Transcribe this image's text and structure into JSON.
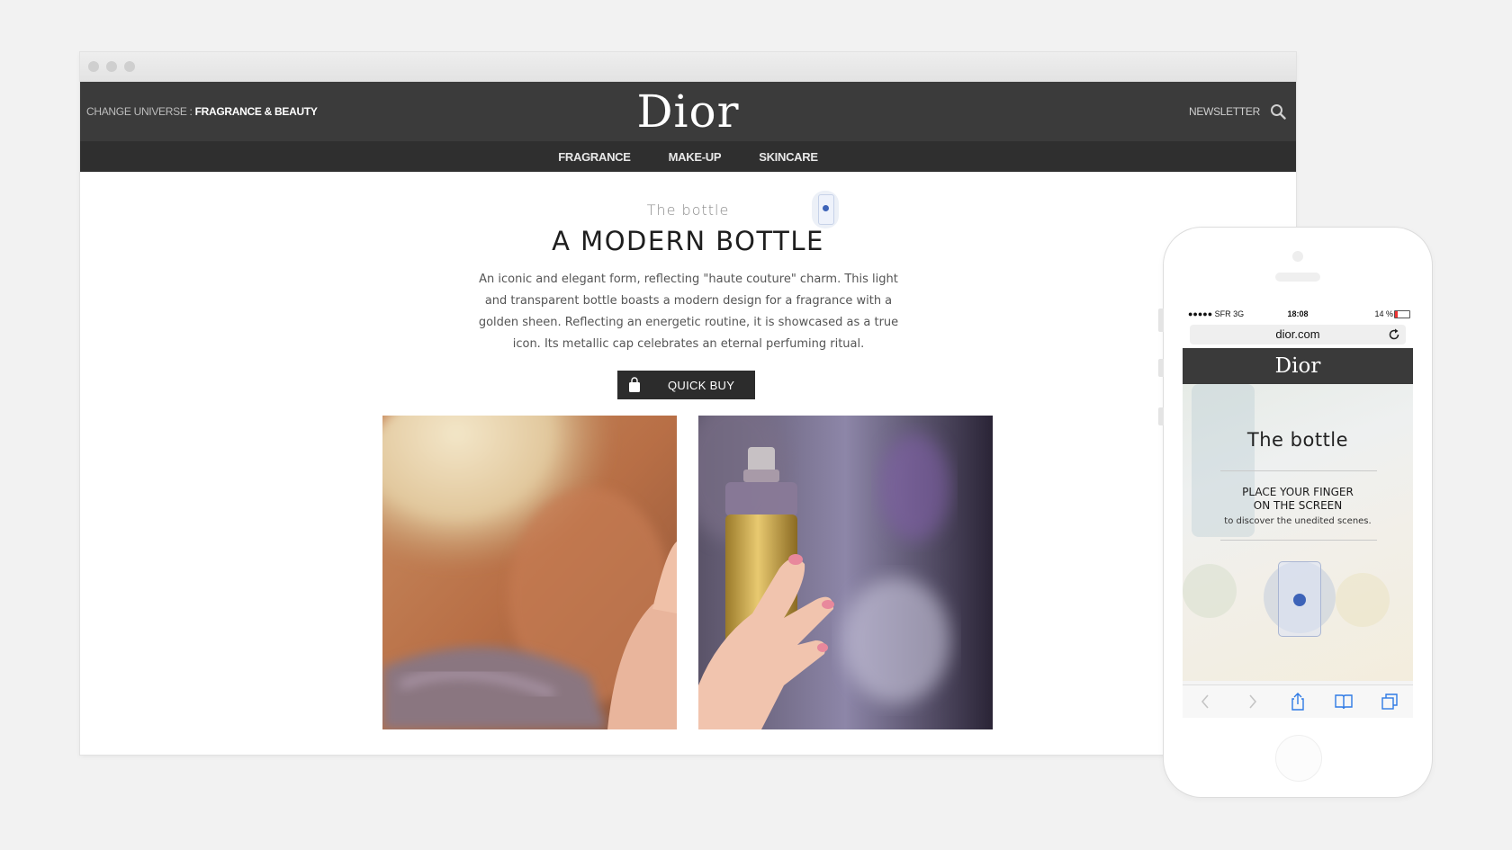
{
  "browser": {
    "header": {
      "change_universe_label": "CHANGE UNIVERSE : ",
      "change_universe_value": "FRAGRANCE & BEAUTY",
      "logo": "Dior",
      "newsletter_label": "NEWSLETTER"
    },
    "nav": {
      "items": [
        {
          "label": "FRAGRANCE"
        },
        {
          "label": "MAKE-UP"
        },
        {
          "label": "SKINCARE"
        }
      ]
    },
    "content": {
      "subtitle": "The bottle",
      "heading": "A MODERN BOTTLE",
      "description": "An iconic and elegant form, reflecting \"haute couture\" charm. This light and transparent bottle boasts a modern design for a fragrance with a golden sheen. Reflecting an energetic routine, it is showcased as a true icon. Its metallic cap celebrates an eternal perfuming ritual.",
      "quick_buy_label": "QUICK BUY"
    }
  },
  "phone": {
    "status": {
      "carrier": "●●●●● SFR  3G",
      "time": "18:08",
      "battery": "14 %"
    },
    "url": "dior.com",
    "logo": "Dior",
    "title": "The bottle",
    "instruction_line1": "PLACE YOUR FINGER",
    "instruction_line2": "ON THE SCREEN",
    "hint": "to discover the unedited scenes."
  },
  "colors": {
    "header_bg": "#3b3b3b",
    "nav_bg": "#2f2f2f",
    "accent_dot": "#3d63b8",
    "page_bg": "#f2f2f2"
  },
  "icons": {
    "search": "search-icon",
    "bag": "shopping-bag-icon",
    "reload": "reload-icon",
    "back": "chevron-left-icon",
    "forward": "chevron-right-icon",
    "share": "share-icon",
    "bookmarks": "book-icon",
    "tabs": "tabs-icon"
  }
}
